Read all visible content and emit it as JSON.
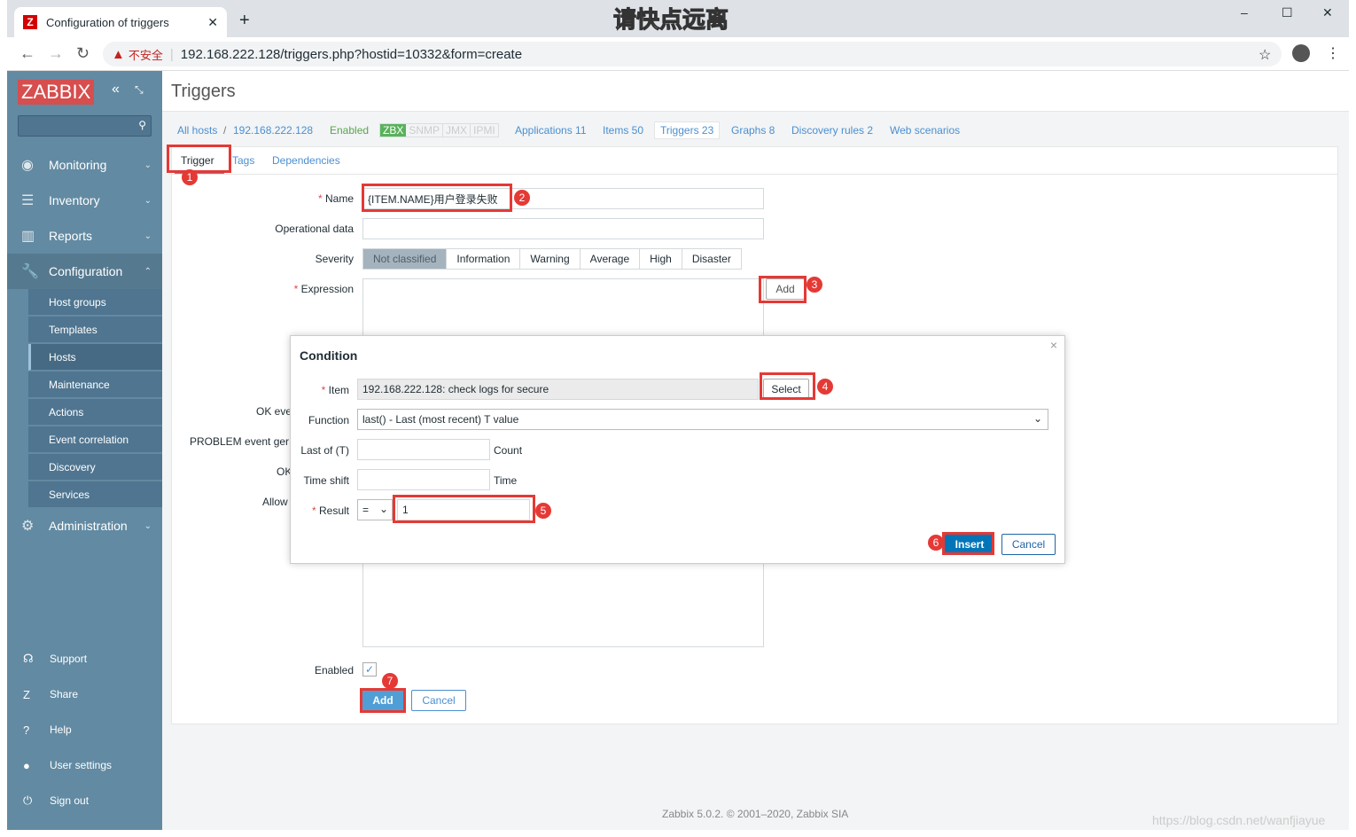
{
  "browser": {
    "tab_title": "Configuration of triggers",
    "new_tab": "+",
    "url": "192.168.222.128/triggers.php?hostid=10332&form=create",
    "security": "不安全",
    "overlay_text": "请快点远离",
    "window_controls": [
      "–",
      "☐",
      "✕"
    ]
  },
  "sidebar": {
    "logo": "ZABBIX",
    "menu": [
      {
        "label": "Monitoring",
        "icon": "eye-icon"
      },
      {
        "label": "Inventory",
        "icon": "list-icon"
      },
      {
        "label": "Reports",
        "icon": "chart-icon"
      },
      {
        "label": "Configuration",
        "icon": "wrench-icon"
      },
      {
        "label": "Administration",
        "icon": "gear-icon"
      }
    ],
    "config_items": [
      "Host groups",
      "Templates",
      "Hosts",
      "Maintenance",
      "Actions",
      "Event correlation",
      "Discovery",
      "Services"
    ],
    "bottom": [
      {
        "label": "Support",
        "icon": "headset-icon"
      },
      {
        "label": "Share",
        "icon": "share-icon"
      },
      {
        "label": "Help",
        "icon": "help-icon"
      },
      {
        "label": "User settings",
        "icon": "user-icon"
      },
      {
        "label": "Sign out",
        "icon": "power-icon"
      }
    ]
  },
  "page": {
    "title": "Triggers",
    "breadcrumb": {
      "all_hosts": "All hosts",
      "host": "192.168.222.128",
      "status": "Enabled",
      "zbx": "ZBX",
      "snmp": "SNMP",
      "jmx": "JMX",
      "ipmi": "IPMI",
      "applications": "Applications 11",
      "items": "Items 50",
      "triggers": "Triggers 23",
      "graphs": "Graphs 8",
      "discovery": "Discovery rules 2",
      "web": "Web scenarios"
    },
    "tabs": [
      "Trigger",
      "Tags",
      "Dependencies"
    ],
    "form": {
      "name_label": "Name",
      "name_value": "{ITEM.NAME}用户登录失败",
      "opdata_label": "Operational data",
      "severity_label": "Severity",
      "severities": [
        "Not classified",
        "Information",
        "Warning",
        "Average",
        "High",
        "Disaster"
      ],
      "selected_severity": "Not classified",
      "expression_label": "Expression",
      "add_expr": "Add",
      "hidden_labels": [
        "OK eve",
        "PROBLEM event ger",
        "OK",
        "Allow"
      ],
      "enabled_label": "Enabled",
      "enabled": true,
      "add": "Add",
      "cancel": "Cancel"
    },
    "footer": "Zabbix 5.0.2. © 2001–2020, Zabbix SIA",
    "watermark": "https://blog.csdn.net/wanfjiayue"
  },
  "dialog": {
    "title": "Condition",
    "close": "×",
    "item_label": "Item",
    "item_value": "192.168.222.128: check logs for secure",
    "select": "Select",
    "function_label": "Function",
    "function_value": "last() - Last (most recent) T value",
    "last_label": "Last of (T)",
    "last_unit": "Count",
    "shift_label": "Time shift",
    "shift_unit": "Time",
    "result_label": "Result",
    "result_op": "=",
    "result_value": "1",
    "insert": "Insert",
    "cancel": "Cancel"
  },
  "steps": [
    "1",
    "2",
    "3",
    "4",
    "5",
    "6",
    "7"
  ]
}
